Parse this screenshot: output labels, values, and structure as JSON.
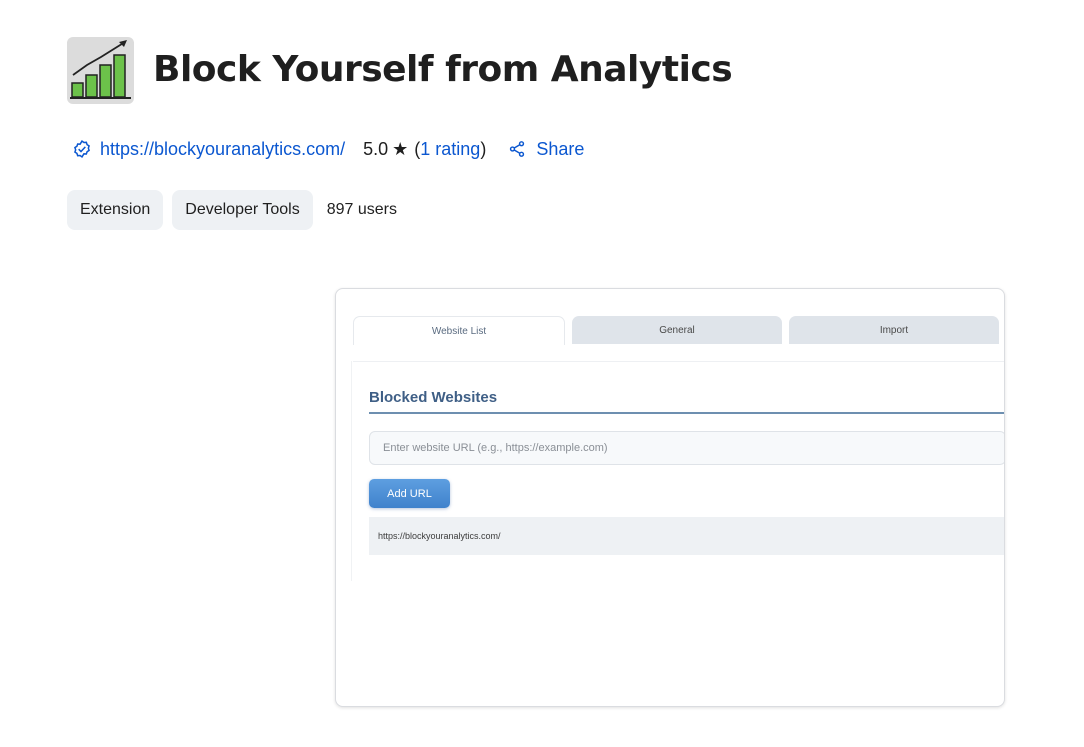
{
  "header": {
    "title": "Block Yourself from Analytics",
    "icon": "bar-chart-growth-icon"
  },
  "meta": {
    "site_url": "https://blockyouranalytics.com/",
    "rating_value": "5.0",
    "rating_star": "★",
    "rating_open": "(",
    "rating_count": "1 rating",
    "rating_close": ")",
    "share_label": "Share"
  },
  "chips": {
    "type": "Extension",
    "category": "Developer Tools",
    "users": "897 users"
  },
  "screenshot": {
    "tabs": [
      {
        "label": "Website List",
        "active": true
      },
      {
        "label": "General",
        "active": false
      },
      {
        "label": "Import",
        "active": false
      }
    ],
    "panel_title": "Blocked Websites",
    "input_placeholder": "Enter website URL (e.g., https://example.com)",
    "add_button": "Add URL",
    "blocked_sites": [
      "https://blockyouranalytics.com/"
    ]
  },
  "colors": {
    "link": "#0b57d0",
    "chip_bg": "#eef1f4",
    "panel_title": "#3f5f86",
    "add_button": "#4a8ed6"
  }
}
